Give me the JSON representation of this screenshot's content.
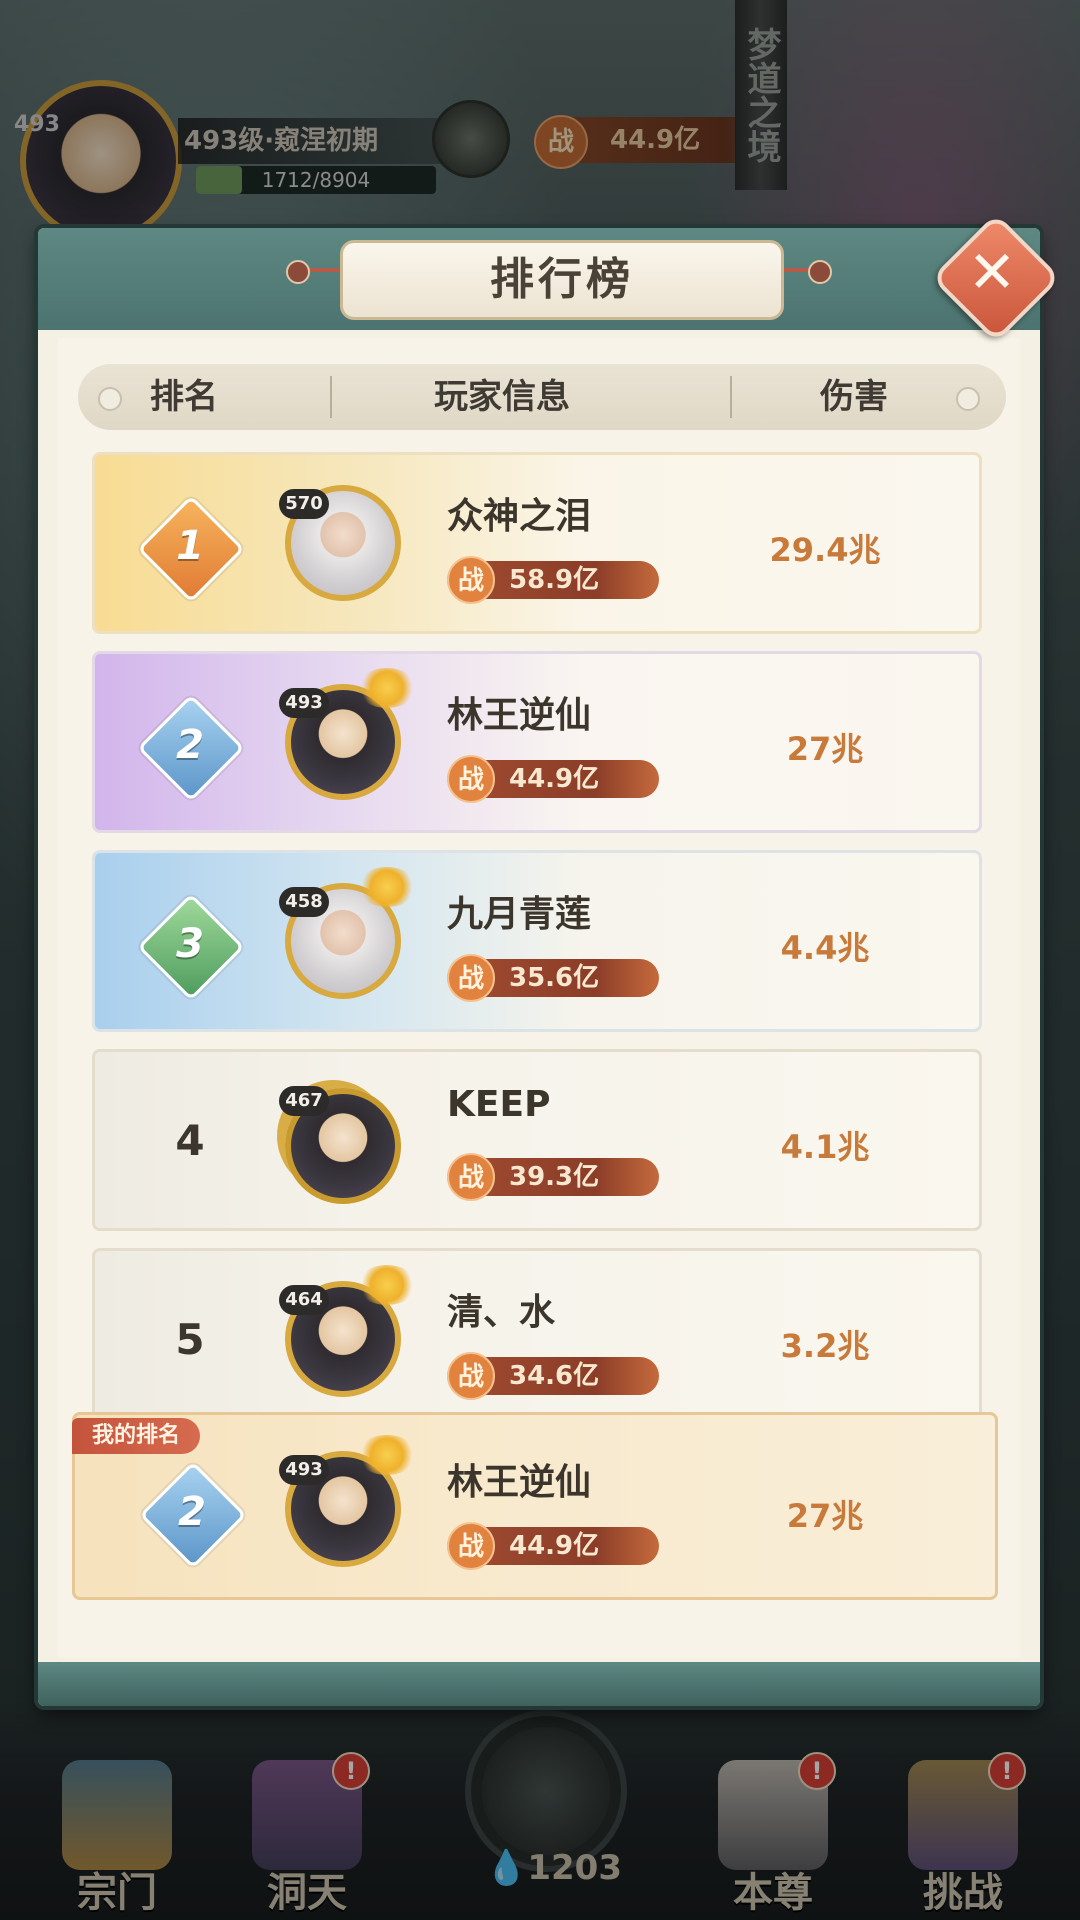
{
  "hud": {
    "level_small": "493",
    "realm": "493级·窥涅初期",
    "exp": "1712/8904",
    "exp_fraction": 0.192,
    "power_icon": "战",
    "power": "44.9亿",
    "side_scroll": "梦道之境"
  },
  "modal": {
    "title": "排行榜",
    "close_icon": "close-x-icon",
    "columns": {
      "rank": "排名",
      "player": "玩家信息",
      "damage": "伤害"
    }
  },
  "rows": [
    {
      "rank": "1",
      "level": "570",
      "name": "众神之泪",
      "power": "58.9亿",
      "damage": "29.4兆"
    },
    {
      "rank": "2",
      "level": "493",
      "name": "林王逆仙",
      "power": "44.9亿",
      "damage": "27兆"
    },
    {
      "rank": "3",
      "level": "458",
      "name": "九月青莲",
      "power": "35.6亿",
      "damage": "4.4兆"
    },
    {
      "rank": "4",
      "level": "467",
      "name": "KEEP",
      "power": "39.3亿",
      "damage": "4.1兆"
    },
    {
      "rank": "5",
      "level": "464",
      "name": "清、水",
      "power": "34.6亿",
      "damage": "3.2兆"
    }
  ],
  "my_rank": {
    "tag": "我的排名",
    "rank": "2",
    "level": "493",
    "name": "林王逆仙",
    "power": "44.9亿",
    "damage": "27兆"
  },
  "power_icon": "战",
  "bottom_nav": {
    "items": [
      {
        "label": "宗门",
        "badge": ""
      },
      {
        "label": "洞天",
        "badge": "!"
      },
      {
        "label": "本尊",
        "badge": "!"
      },
      {
        "label": "挑战",
        "badge": "!"
      }
    ],
    "center_count": "1203"
  },
  "colors": {
    "accent": "#c87a3b",
    "header": "#5e8883",
    "close": "#e2725a"
  }
}
